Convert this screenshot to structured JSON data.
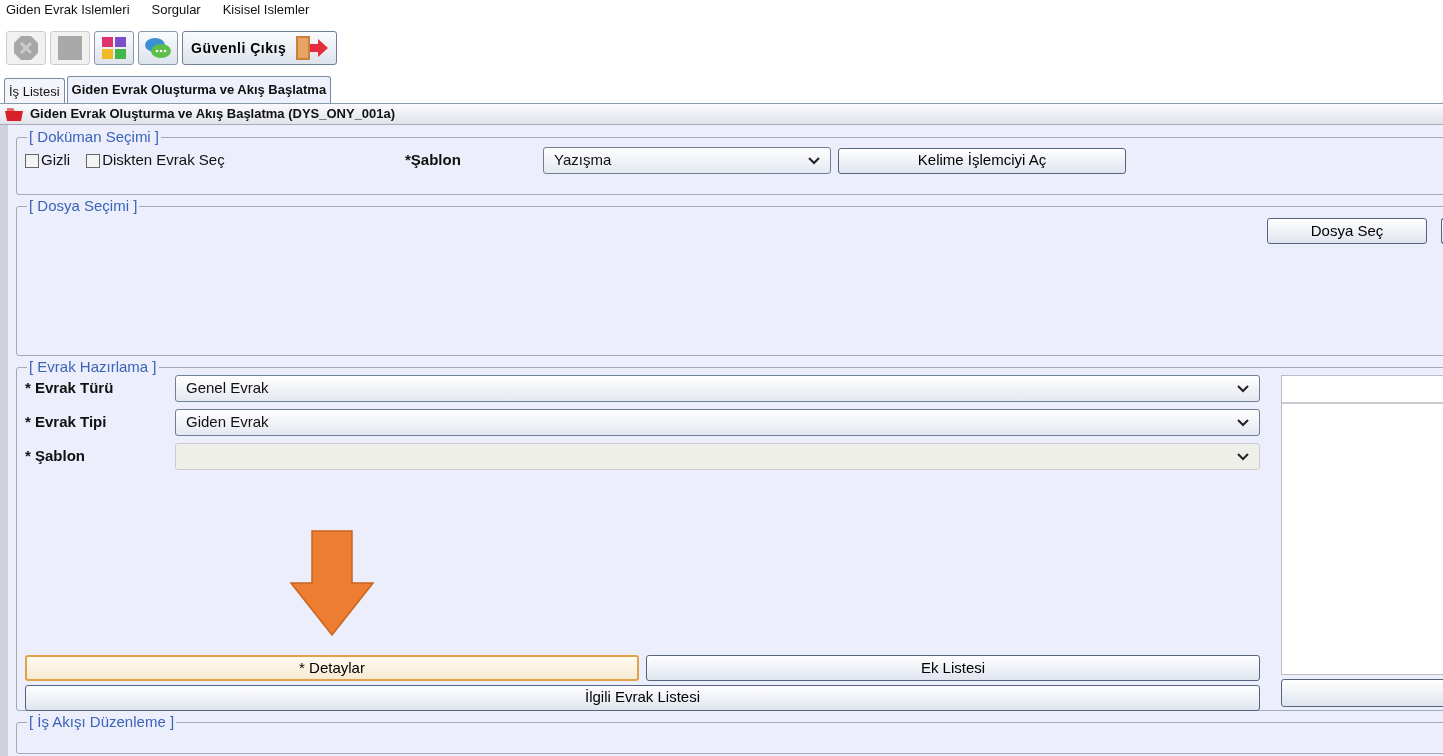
{
  "menu": [
    {
      "label": "Giden Evrak Islemleri"
    },
    {
      "label": "Sorgular"
    },
    {
      "label": "Kisisel Islemler"
    }
  ],
  "toolbar": {
    "buttons": [
      {
        "disabled": true
      },
      {
        "disabled": true
      },
      {
        "disabled": false
      },
      {
        "disabled": false
      }
    ],
    "exit_button": {
      "label": "Güvenli Çıkış"
    }
  },
  "tabs": [
    {
      "label": "İş Listesi",
      "selected": false
    },
    {
      "label": "Giden Evrak Oluşturma ve Akış Başlatma",
      "selected": true
    }
  ],
  "panel_title": "Giden Evrak Oluşturma ve Akış Başlatma (DYS_ONY_001a)",
  "document_selection": {
    "legend": "[ Doküman Seçimi ]",
    "checkboxes": [
      {
        "label": "Gizli",
        "checked": false
      },
      {
        "label": "Diskten Evrak Seç",
        "checked": false
      }
    ],
    "template_label": "*Şablon",
    "template_value": "Yazışma",
    "open_button": "Kelime İşlemciyi Aç"
  },
  "file_selection": {
    "legend": "[ Dosya Seçimi ]",
    "select_button": "Dosya Seç"
  },
  "document_preparation": {
    "legend": "[ Evrak Hazırlama ]",
    "fields": [
      {
        "label": "* Evrak Türü",
        "value": "Genel Evrak",
        "disabled": false
      },
      {
        "label": "* Evrak Tipi",
        "value": "Giden Evrak",
        "disabled": false
      },
      {
        "label": "* Şablon",
        "disabled": true
      }
    ],
    "buttons": [
      {
        "label": "* Detaylar",
        "focused": true
      },
      {
        "label": "Ek Listesi",
        "focused": false
      },
      {
        "label": "İlgili Evrak Listesi",
        "focused": false
      }
    ]
  },
  "workflow": {
    "legend": "[ İş Akışı Düzenleme ]"
  }
}
